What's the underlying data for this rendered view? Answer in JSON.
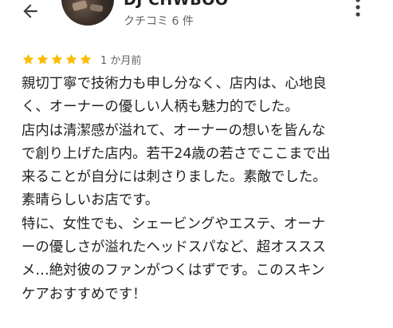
{
  "header": {
    "user_name": "DJ CHWBOO",
    "review_count": "クチコミ 6 件"
  },
  "review": {
    "rating": 5,
    "rating_max": 5,
    "time": "1 か月前",
    "lines": [
      "親切丁寧で技術力も申し分なく、店内は、心地良",
      "く、オーナーの優しい人柄も魅力的でした。",
      "店内は清潔感が溢れて、オーナーの想いを皆んな",
      "で創り上げた店内。若干24歳の若さでここまで出",
      "来ることが自分には刺さりました。素敵でした。",
      "素晴らしいお店です。",
      "特に、女性でも、シェービングやエステ、オーナ",
      "ーの優しさが溢れたヘッドスパなど、超オススス",
      "メ…絶対彼のファンがつくはずです。このスキン",
      "ケアおすすめです！"
    ]
  },
  "icons": {
    "back": "arrow-left-icon",
    "more": "more-vert-icon",
    "star": "star-icon"
  },
  "colors": {
    "star": "#fbbc04",
    "secondary_text": "#5f6368",
    "primary_text": "#202124"
  }
}
